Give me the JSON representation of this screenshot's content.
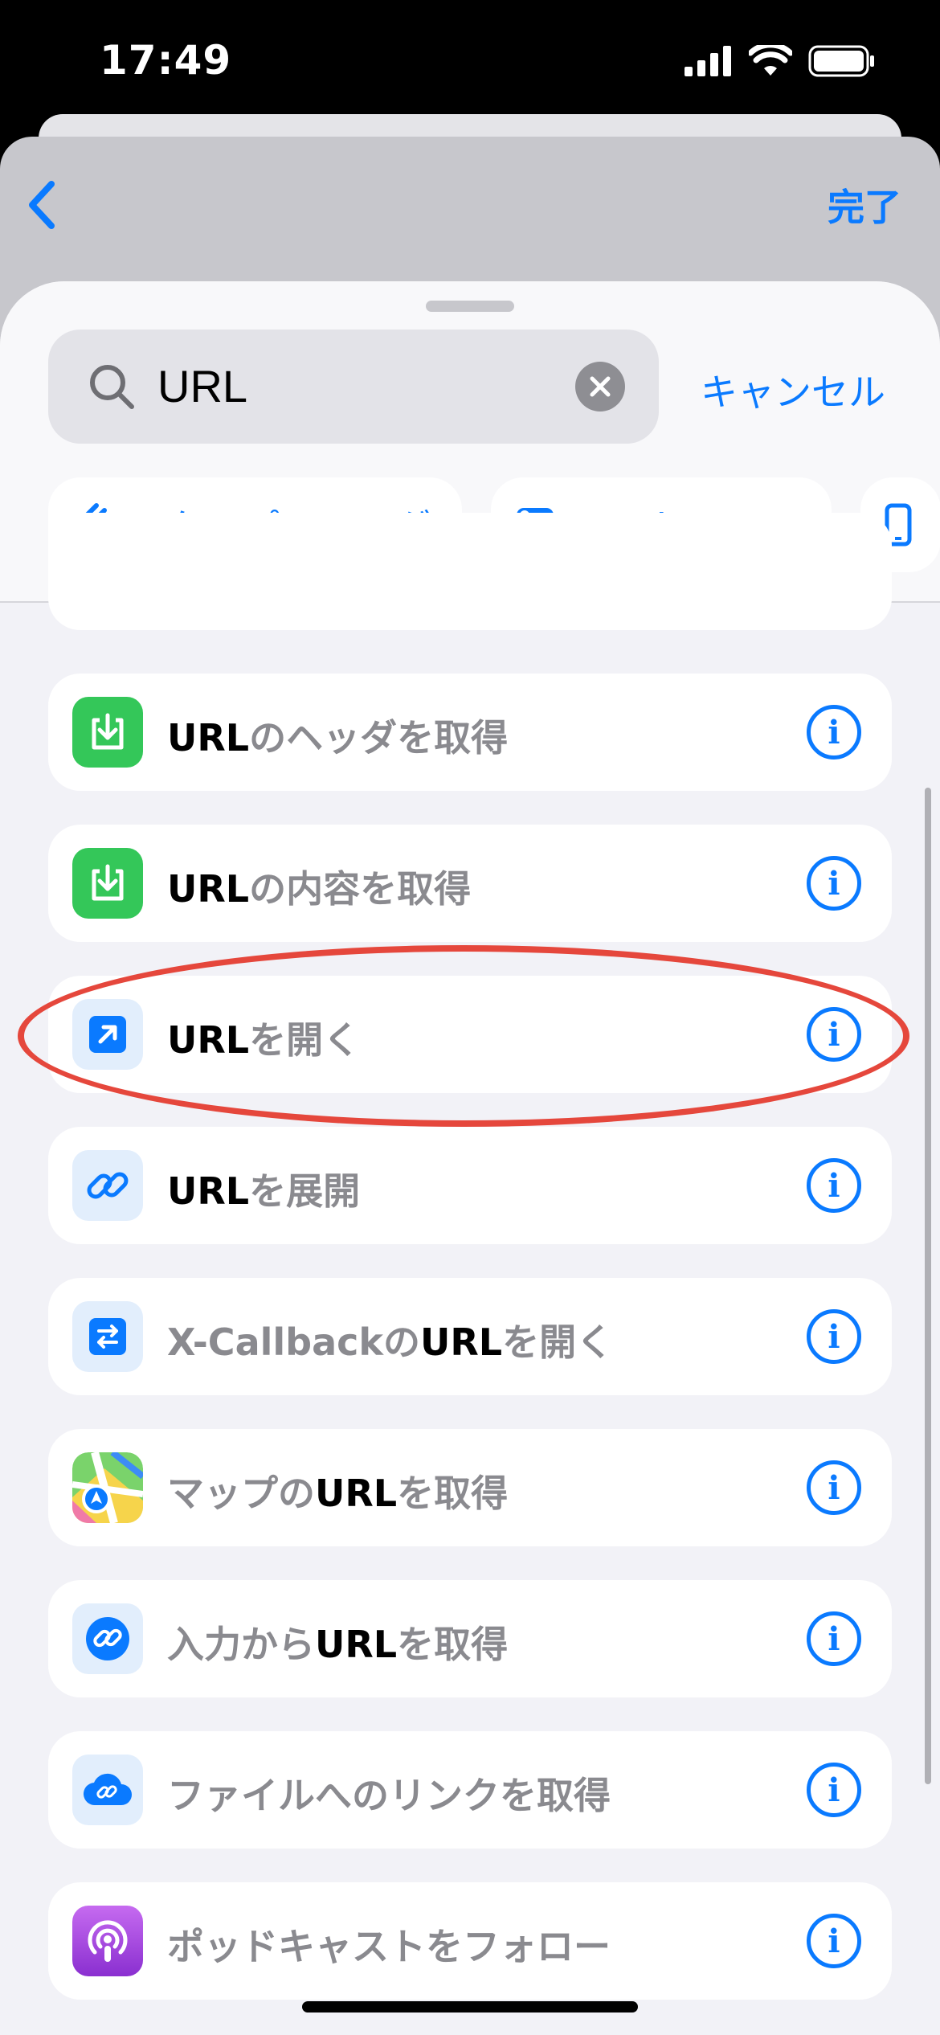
{
  "status_bar": {
    "time": "17:49"
  },
  "nav": {
    "done_label": "完了"
  },
  "search": {
    "value": "URL",
    "cancel_label": "キャンセル"
  },
  "chips": [
    {
      "label": "スクリプティング",
      "icon": "scripting-icon"
    },
    {
      "label": "コントロール",
      "icon": "toggle-icon"
    },
    {
      "label": "",
      "icon": "device-icon"
    }
  ],
  "results": [
    {
      "pre": "",
      "bold": "URL",
      "post": "のヘッダを取得",
      "icon": "download-icon",
      "icon_color": "#34c759"
    },
    {
      "pre": "",
      "bold": "URL",
      "post": "の内容を取得",
      "icon": "download-icon",
      "icon_color": "#34c759"
    },
    {
      "pre": "",
      "bold": "URL",
      "post": "を開く",
      "icon": "open-arrow-icon",
      "icon_color": "#0a7aff"
    },
    {
      "pre": "",
      "bold": "URL",
      "post": "を展開",
      "icon": "link-icon",
      "icon_color": "#0a7aff"
    },
    {
      "pre": "X-Callbackの",
      "bold": "URL",
      "post": "を開く",
      "icon": "swap-arrows-icon",
      "icon_color": "#0a7aff"
    },
    {
      "pre": "マップの",
      "bold": "URL",
      "post": "を取得",
      "icon": "maps-icon",
      "icon_color": "#4cd964"
    },
    {
      "pre": "入力から",
      "bold": "URL",
      "post": "を取得",
      "icon": "link-circle-icon",
      "icon_color": "#0a7aff"
    },
    {
      "pre": "ファイルへのリンクを取得",
      "bold": "",
      "post": "",
      "icon": "cloud-link-icon",
      "icon_color": "#0a7aff"
    },
    {
      "pre": "ポッドキャストをフォロー",
      "bold": "",
      "post": "",
      "icon": "podcasts-icon",
      "icon_color": "#9b3fd6"
    }
  ],
  "highlighted_result": 2,
  "colors": {
    "accent": "#0a7aff",
    "highlight": "#e5473c"
  }
}
